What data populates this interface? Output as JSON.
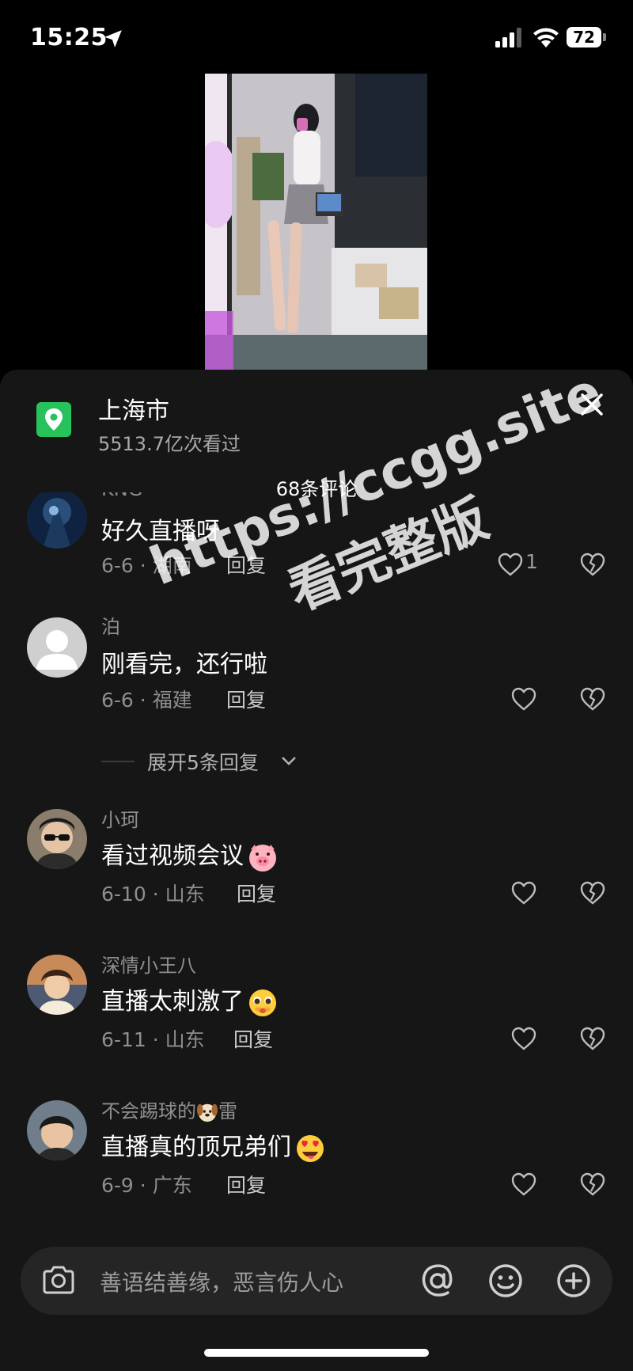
{
  "status_bar": {
    "time": "15:25",
    "battery_level": "72",
    "icons": [
      "location-arrow-icon",
      "signal-icon",
      "wifi-icon",
      "battery-icon"
    ]
  },
  "location": {
    "name": "上海市",
    "views": "5513.7亿次看过",
    "icon": "map-pin-icon",
    "accent": "#27c25c"
  },
  "comment_count_label": "68条评论",
  "comments": [
    {
      "user": "KNG",
      "text": "好久直播呀",
      "date": "6-6",
      "region": "湖南",
      "reply_label": "回复",
      "likes": "1"
    },
    {
      "user": "泊",
      "text": "刚看完，还行啦",
      "date": "6-6",
      "region": "福建",
      "reply_label": "回复",
      "likes": ""
    },
    {
      "user": "小珂",
      "text": "看过视频会议",
      "emoji": "pig-face-emoji",
      "date": "6-10",
      "region": "山东",
      "reply_label": "回复",
      "likes": ""
    },
    {
      "user": "深情小王八",
      "text": "直播太刺激了",
      "emoji": "pleading-face-emoji",
      "date": "6-11",
      "region": "山东",
      "reply_label": "回复",
      "likes": ""
    },
    {
      "user_prefix": "不会踢球的",
      "user_emoji": "dog-face-emoji",
      "user_suffix": "雷",
      "text": "直播真的顶兄弟们",
      "emoji": "heart-eyes-emoji",
      "date": "6-9",
      "region": "广东",
      "reply_label": "回复",
      "likes": ""
    }
  ],
  "expand_replies": "展开5条回复",
  "watermark": {
    "line1": "https://ccgg.site",
    "line2": "看完整版"
  },
  "input": {
    "placeholder": "善语结善缘，恶言伤人心"
  }
}
